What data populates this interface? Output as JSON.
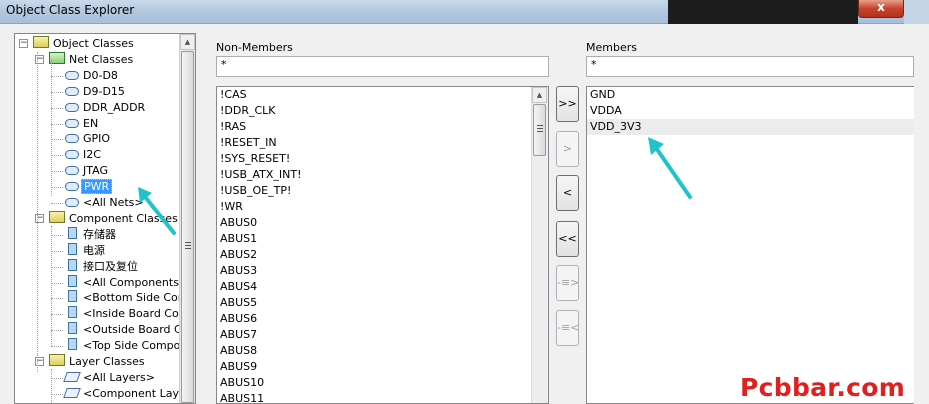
{
  "window": {
    "title": "Object Class Explorer",
    "close_label": "x"
  },
  "tree": {
    "items": [
      {
        "label": "Object Classes",
        "level": 0,
        "icon": "object-classes-icon",
        "expanded": true
      },
      {
        "label": "Net Classes",
        "level": 1,
        "icon": "net-classes-folder-icon",
        "expanded": true
      },
      {
        "label": "D0-D8",
        "level": 2,
        "icon": "net-class-icon"
      },
      {
        "label": "D9-D15",
        "level": 2,
        "icon": "net-class-icon"
      },
      {
        "label": "DDR_ADDR",
        "level": 2,
        "icon": "net-class-icon"
      },
      {
        "label": "EN",
        "level": 2,
        "icon": "net-class-icon"
      },
      {
        "label": "GPIO",
        "level": 2,
        "icon": "net-class-icon"
      },
      {
        "label": "I2C",
        "level": 2,
        "icon": "net-class-icon"
      },
      {
        "label": "JTAG",
        "level": 2,
        "icon": "net-class-icon"
      },
      {
        "label": "PWR",
        "level": 2,
        "icon": "net-class-icon",
        "selected": true
      },
      {
        "label": "<All Nets>",
        "level": 2,
        "icon": "net-class-icon"
      },
      {
        "label": "Component Classes",
        "level": 1,
        "icon": "component-classes-folder-icon",
        "expanded": true
      },
      {
        "label": "存储器",
        "level": 2,
        "icon": "component-class-icon"
      },
      {
        "label": "电源",
        "level": 2,
        "icon": "component-class-icon"
      },
      {
        "label": "接口及复位",
        "level": 2,
        "icon": "component-class-icon"
      },
      {
        "label": "<All Components>",
        "level": 2,
        "icon": "component-class-icon"
      },
      {
        "label": "<Bottom Side Compo",
        "level": 2,
        "icon": "component-class-icon"
      },
      {
        "label": "<Inside Board Comp",
        "level": 2,
        "icon": "component-class-icon"
      },
      {
        "label": "<Outside Board Com",
        "level": 2,
        "icon": "component-class-icon"
      },
      {
        "label": "<Top Side Compone",
        "level": 2,
        "icon": "component-class-icon"
      },
      {
        "label": "Layer Classes",
        "level": 1,
        "icon": "layer-classes-folder-icon",
        "expanded": true
      },
      {
        "label": "<All Layers>",
        "level": 2,
        "icon": "layer-class-icon"
      },
      {
        "label": "<Component Layers:",
        "level": 2,
        "icon": "layer-class-icon"
      }
    ]
  },
  "non_members": {
    "header": "Non-Members",
    "filter": "*",
    "items": [
      "!CAS",
      "!DDR_CLK",
      "!RAS",
      "!RESET_IN",
      "!SYS_RESET!",
      "!USB_ATX_INT!",
      "!USB_OE_TP!",
      "!WR",
      "ABUS0",
      "ABUS1",
      "ABUS2",
      "ABUS3",
      "ABUS4",
      "ABUS5",
      "ABUS6",
      "ABUS7",
      "ABUS8",
      "ABUS9",
      "ABUS10",
      "ABUS11"
    ]
  },
  "members": {
    "header": "Members",
    "filter": "*",
    "items": [
      "GND",
      "VDDA",
      "VDD_3V3"
    ],
    "selected_index": 2
  },
  "buttons": {
    "add_all": ">>",
    "add": ">",
    "remove": "<",
    "remove_all": "<<",
    "move_in": "-≡>",
    "move_out": "-≡<"
  },
  "watermark": "Pcbbar.com",
  "colors": {
    "accent": "#3399ff",
    "arrow": "#1fc3c9",
    "watermark": "#e02020"
  }
}
